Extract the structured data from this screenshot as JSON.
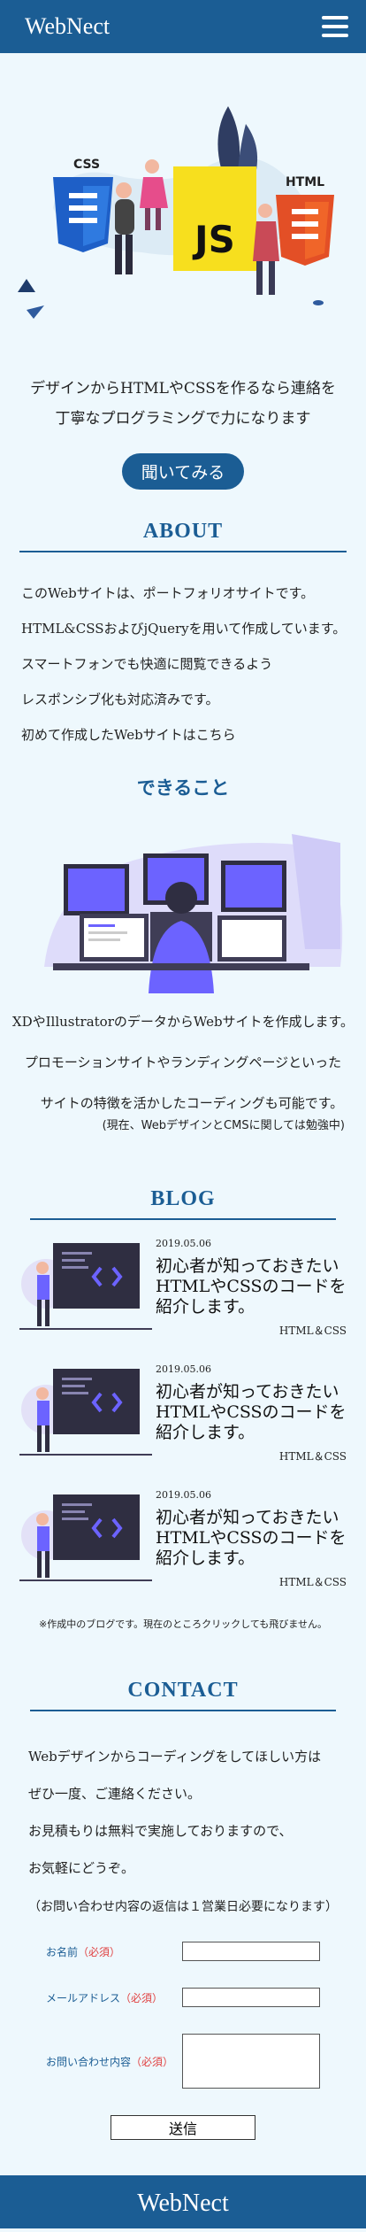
{
  "header": {
    "logo": "WebNect",
    "menu_icon": "hamburger-icon"
  },
  "hero": {
    "icon_labels": {
      "css": "CSS",
      "js": "JS",
      "html": "HTML"
    },
    "line1": "デザインからHTMLやCSSを作るなら連絡を",
    "line2": "丁寧なプログラミングで力になります",
    "cta": "聞いてみる"
  },
  "about": {
    "title": "ABOUT",
    "lines": [
      "このWebサイトは、ポートフォリオサイトです。",
      "HTML&CSSおよびjQueryを用いて作成しています。",
      "スマートフォンでも快適に閲覧できるよう",
      "レスポンシブ化も対応済みです。",
      "初めて作成したWebサイトはこちら"
    ]
  },
  "can": {
    "title": "できること",
    "p1": "XDやIllustratorのデータからWebサイトを作成します。",
    "p2": "プロモーションサイトやランディングページといった",
    "p3": "サイトの特徴を活かしたコーディングも可能です。",
    "note": "(現在、WebデザインとCMSに関しては勉強中)"
  },
  "blog": {
    "title": "BLOG",
    "posts": [
      {
        "date": "2019.05.06",
        "title": "初心者が知っておきたいHTMLやCSSのコードを紹介します。",
        "tag": "HTML＆CSS"
      },
      {
        "date": "2019.05.06",
        "title": "初心者が知っておきたいHTMLやCSSのコードを紹介します。",
        "tag": "HTML＆CSS"
      },
      {
        "date": "2019.05.06",
        "title": "初心者が知っておきたいHTMLやCSSのコードを紹介します。",
        "tag": "HTML＆CSS"
      }
    ],
    "note": "※作成中のブログです。現在のところクリックしても飛びません。"
  },
  "contact": {
    "title": "CONTACT",
    "lines": [
      "Webデザインからコーディングをしてほしい方は",
      "ぜひ一度、ご連絡ください。",
      "お見積もりは無料で実施しておりますので、",
      "お気軽にどうぞ。"
    ],
    "note": "（お問い合わせ内容の返信は１営業日必要になります）",
    "name_label": "お名前",
    "email_label": "メールアドレス",
    "message_label": "お問い合わせ内容",
    "required": "（必須）",
    "submit": "送信"
  },
  "footer": {
    "logo": "WebNect"
  },
  "colors": {
    "brand": "#1b5d94",
    "background": "#eef8fd",
    "accent_purple": "#6c63ff",
    "required_red": "#e04040"
  }
}
